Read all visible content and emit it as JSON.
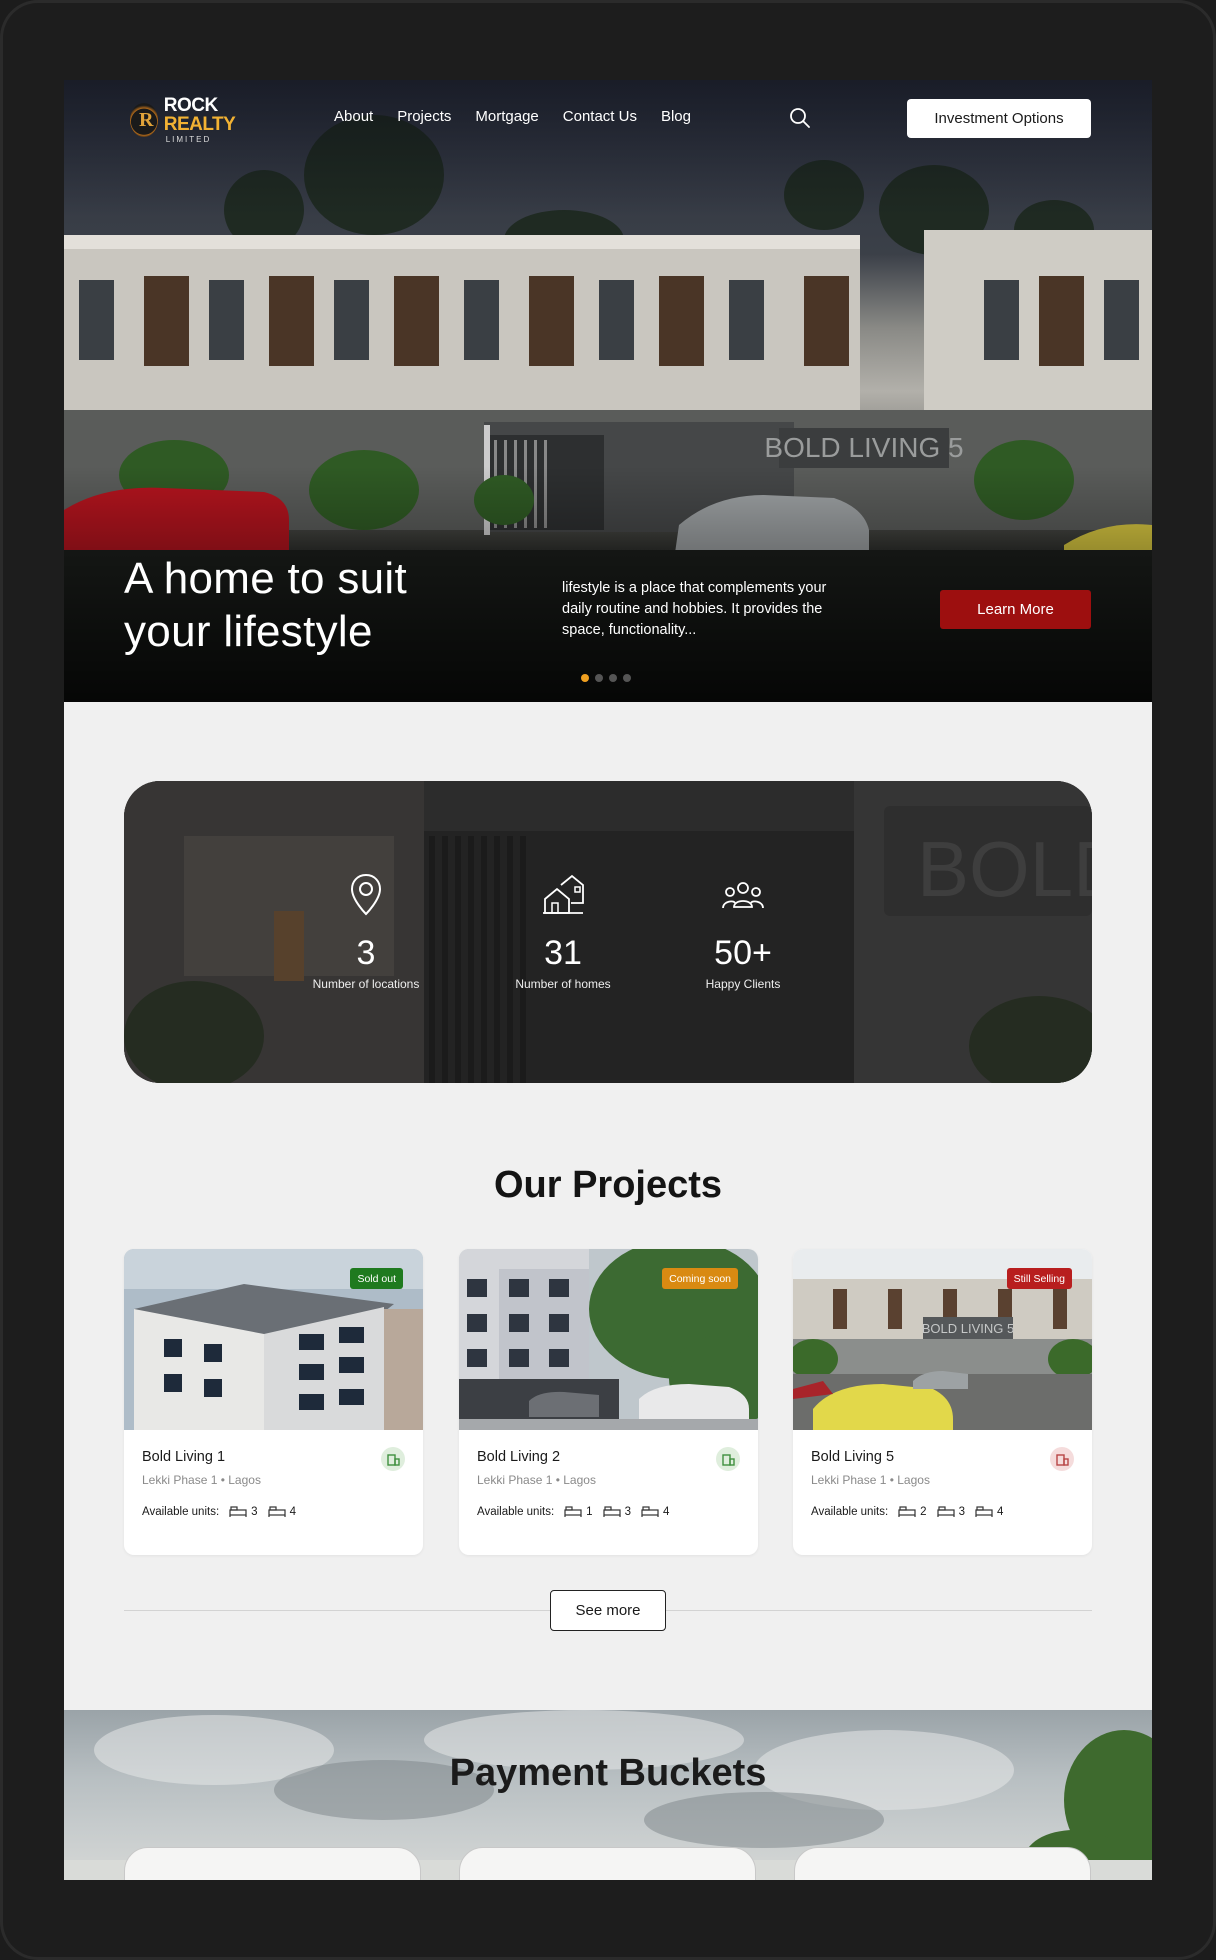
{
  "brand": {
    "name_part1": "ROCK",
    "name_part2": "REALTY",
    "sub": "LIMITED",
    "mark": "R"
  },
  "nav": {
    "links": [
      "About",
      "Projects",
      "Mortgage",
      "Contact Us",
      "Blog"
    ],
    "cta": "Investment Options"
  },
  "hero": {
    "title": "A home to suit your lifestyle",
    "description": "lifestyle is a place that complements your daily routine and hobbies. It provides the space, functionality...",
    "button": "Learn More",
    "signage": "BOLD LIVING 5",
    "slides": 4,
    "active_slide": 1
  },
  "stats": [
    {
      "value": "3",
      "label": "Number of locations",
      "icon": "map-pin-icon"
    },
    {
      "value": "31",
      "label": "Number of homes",
      "icon": "houses-icon"
    },
    {
      "value": "50+",
      "label": "Happy Clients",
      "icon": "people-icon"
    }
  ],
  "stats_signage": "BOLD",
  "projects": {
    "title": "Our Projects",
    "units_label": "Available units:",
    "items": [
      {
        "name": "Bold Living 1",
        "location": "Lekki Phase 1 • Lagos",
        "badge": "Sold out",
        "badge_color": "#1f7a1f",
        "status_icon": "building-icon",
        "units": [
          "3",
          "4"
        ]
      },
      {
        "name": "Bold Living 2",
        "location": "Lekki Phase 1 • Lagos",
        "badge": "Coming soon",
        "badge_color": "#d98a12",
        "status_icon": "building-icon",
        "units": [
          "1",
          "3",
          "4"
        ]
      },
      {
        "name": "Bold Living 5",
        "location": "Lekki Phase 1 • Lagos",
        "badge": "Still Selling",
        "badge_color": "#b81e1e",
        "status_icon": "building-icon",
        "units": [
          "2",
          "3",
          "4"
        ]
      }
    ],
    "see_more": "See more"
  },
  "payment": {
    "title": "Payment Buckets"
  },
  "colors": {
    "accent_red": "#9d0f0f",
    "dot_active": "#f0a020",
    "brand_gold": "#f2b233"
  }
}
